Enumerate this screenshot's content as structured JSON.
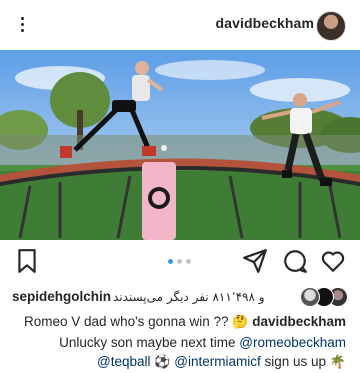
{
  "header": {
    "username": "davidbeckham",
    "menu_icon": "more-vertical-icon"
  },
  "post": {
    "carousel": {
      "count": 3,
      "active_index": 0
    }
  },
  "actions": {
    "save_icon": "bookmark-icon",
    "share_icon": "send-icon",
    "comment_icon": "comment-icon",
    "like_icon": "heart-icon"
  },
  "likes": {
    "liker_username": "sepidehgolchin",
    "text": "و ۸۱۱٬۴۹۸ نفر دیگر می‌پسندند"
  },
  "caption": {
    "author": "davidbeckham",
    "line1_text": "Romeo V dad who's gonna win ??",
    "line1_emoji": "🤔",
    "line2_text": "Unlucky son maybe next time",
    "mention1": "@romeobeckham",
    "mention2": "@teqball",
    "emoji_ball": "⚽",
    "mention3": "@intermiamicf",
    "line3_tail": "sign us up",
    "emoji_palm": "🌴"
  },
  "colors": {
    "text": "#262626",
    "mention": "#003569",
    "dot_active": "#3897f0",
    "dot_inactive": "#c7c7c7"
  }
}
